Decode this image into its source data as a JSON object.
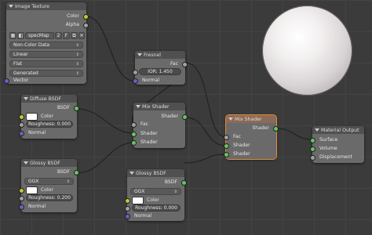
{
  "colors": {
    "canvas": "#3b3b3b",
    "node": "#6a6a6a",
    "header": "#505050",
    "active_outline": "#e08b3a",
    "socket_color": "#c7c729",
    "socket_float": "#a1a1a1",
    "socket_shader": "#63c763",
    "socket_vector": "#6363c7"
  },
  "nodes": {
    "image_texture": {
      "title": "Image Texture",
      "out_color": "Color",
      "out_alpha": "Alpha",
      "image_name": "specMap",
      "users": "2",
      "fake": "F",
      "color_space": "Non-Color Data",
      "interpolation": "Linear",
      "projection": "Flat",
      "extension": "Generated",
      "in_vector": "Vector"
    },
    "diffuse_bsdf": {
      "title": "Diffuse BSDF",
      "out_bsdf": "BSDF",
      "in_color": "Color",
      "roughness": "Roughness: 0.000",
      "in_normal": "Normal"
    },
    "glossy_bsdf_1": {
      "title": "Glossy BSDF",
      "out_bsdf": "BSDF",
      "distribution": "GGX",
      "in_color": "Color",
      "roughness": "Roughness: 0.200",
      "in_normal": "Normal"
    },
    "fresnel": {
      "title": "Fresnel",
      "out_fac": "Fac",
      "ior": "IOR:       1.450",
      "in_normal": "Normal"
    },
    "mix_shader_1": {
      "title": "Mix Shader",
      "out_shader": "Shader",
      "in_fac": "Fac",
      "in_shader_1": "Shader",
      "in_shader_2": "Shader"
    },
    "glossy_bsdf_2": {
      "title": "Glossy BSDF",
      "out_bsdf": "BSDF",
      "distribution": "GGX",
      "in_color": "Color",
      "roughness": "Roughness: 0.000",
      "in_normal": "Normal"
    },
    "mix_shader_2": {
      "title": "Mix Shader",
      "out_shader": "Shader",
      "in_fac": "Fac",
      "in_shader_1": "Shader",
      "in_shader_2": "Shader"
    },
    "material_output": {
      "title": "Material Output",
      "in_surface": "Surface",
      "in_volume": "Volume",
      "in_displacement": "Displacement"
    }
  }
}
